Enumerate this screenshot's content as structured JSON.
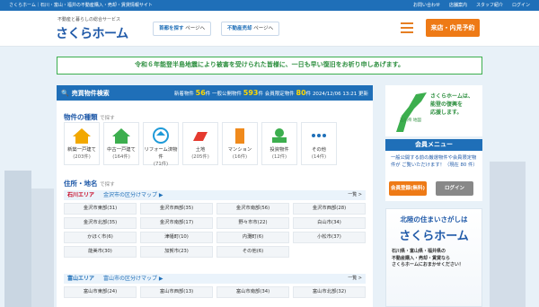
{
  "topbar": {
    "left": "さくらホーム｜石川・富山・福井の不動産購入・売却・賃貸情報サイト",
    "links": [
      "お問い合わせ",
      "店舗案内",
      "スタッフ紹介",
      "ログイン"
    ]
  },
  "header": {
    "sub": "不動産と暮らしの総合サービス",
    "logo": "さくらホーム",
    "btn1_a": "首都を探す",
    "btn1_b": "ページへ",
    "btn2_a": "不動産売却",
    "btn2_b": "ページへ",
    "shop": "来店・内見予約"
  },
  "notice": "令和６年能登半島地震により被害を受けられた皆様に、一日も早い復旧をお祈り申しあげます。",
  "search": {
    "title": "売買物件検索",
    "new_label": "新着物件",
    "new_count": "56",
    "new_unit": "件",
    "general_label": "一般公開物件",
    "general_count": "593",
    "general_unit": "件",
    "member_label": "会員限定物件",
    "member_count": "80",
    "member_unit": "件",
    "updated": "2024/12/06 13:21 更新",
    "type_section": "物件の種類",
    "type_hint": "で探す",
    "types": [
      {
        "label": "新築一戸建て",
        "count": "(203件)"
      },
      {
        "label": "中古一戸建て",
        "count": "(164件)"
      },
      {
        "label": "リフォーム済物件",
        "count": "(71件)"
      },
      {
        "label": "土地",
        "count": "(205件)"
      },
      {
        "label": "マンション",
        "count": "(16件)"
      },
      {
        "label": "投資物件",
        "count": "(12件)"
      },
      {
        "label": "その他",
        "count": "(14件)"
      }
    ],
    "area_section": "住所・地名",
    "area_hint": "で探す",
    "area1": {
      "name": "石川エリア",
      "map": "金沢市の区分けマップ ▶",
      "all": "一覧 >",
      "cities": [
        "金沢市東部(31)",
        "金沢市西部(35)",
        "金沢市南部(56)",
        "金沢市西部(28)",
        "金沢市北部(35)",
        "金沢市南部(17)",
        "野々市市(22)",
        "白山市(34)",
        "かほく市(6)",
        "津幡町(10)",
        "内灘町(6)",
        "小松市(37)",
        "能美市(30)",
        "加賀市(23)",
        "その他(6)"
      ]
    },
    "area2": {
      "name": "富山エリア",
      "map": "富山市の区分けマップ ▶",
      "all": "一覧 >",
      "cities": [
        "富山市東部(24)",
        "富山市西部(13)",
        "富山市南部(34)",
        "富山市北部(32)"
      ]
    }
  },
  "side": {
    "ad_text": [
      "さくらホームは、",
      "能登の復興を",
      "応援します。"
    ],
    "ad_small": "石川県 地図",
    "member_title": "会員メニュー",
    "member_text": "一般公開する前の厳選物件や会員限定物件が ご覧いただけます！（現在 80 件）",
    "register": "会員登録(無料)",
    "login": "ログイン",
    "adv_l1": "北陸の住まいさがしは",
    "adv_l2": "さくらホーム",
    "adv_l3": [
      "石川県・富山県・福井県の",
      "不動産購入・売却・賃貸なら",
      "さくらホームにおまかせください！"
    ]
  },
  "colors": {
    "primary": "#1f6fb8",
    "accent": "#ee7a16",
    "notice": "#3cae4e"
  }
}
